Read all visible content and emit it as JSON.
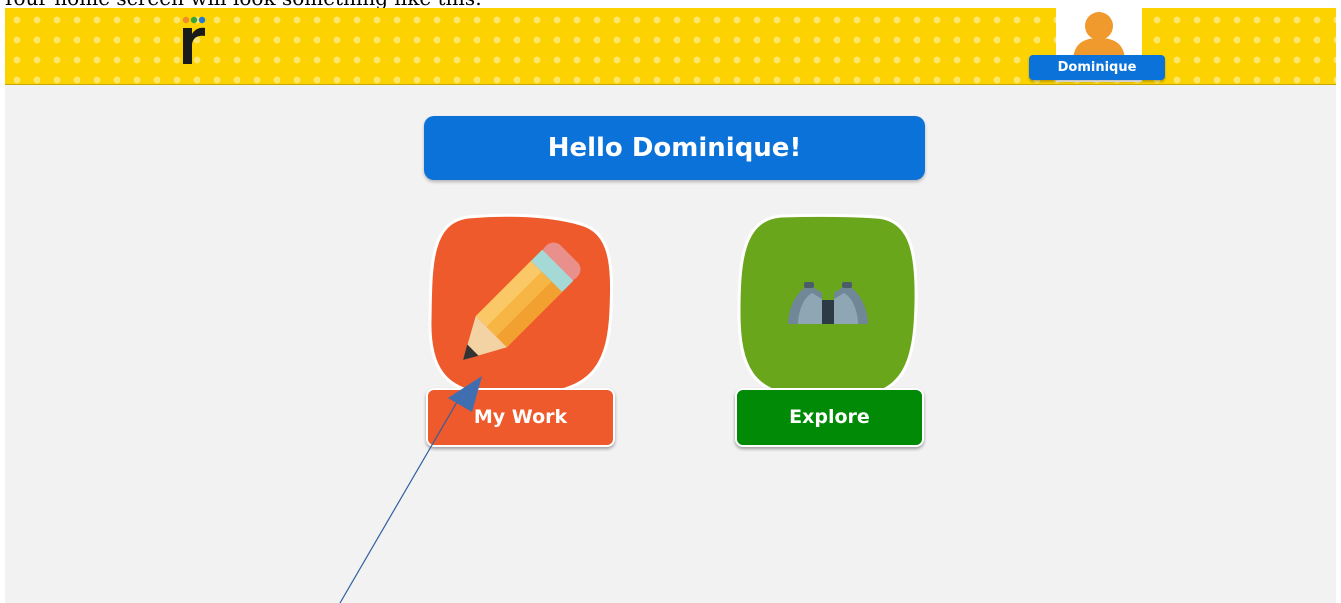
{
  "document": {
    "caption": "Your home screen will look something like this:"
  },
  "header": {
    "logo_icon": "readworks-r-logo",
    "profile": {
      "avatar_icon": "user-avatar-icon",
      "name": "Dominique"
    },
    "colors": {
      "background": "#fcd200",
      "dots": "#fde66b"
    }
  },
  "greeting": {
    "text": "Hello Dominique!",
    "color": "#0a72d8"
  },
  "tiles": [
    {
      "id": "my-work",
      "label": "My Work",
      "icon": "pencil-icon",
      "color": "#ee5a2c"
    },
    {
      "id": "explore",
      "label": "Explore",
      "icon": "binoculars-icon",
      "color": "#6aa61c",
      "label_color": "#008a06"
    }
  ],
  "annotation": {
    "type": "arrow",
    "color": "#2f5f9e",
    "points_to": "my-work-tile"
  }
}
